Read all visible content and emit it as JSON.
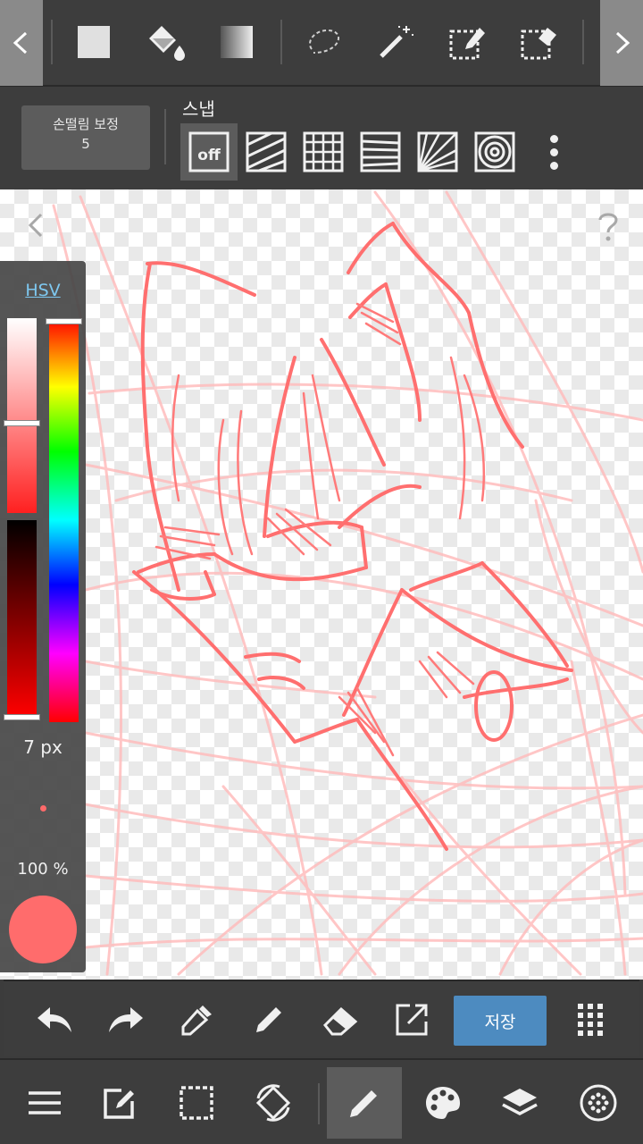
{
  "top_tools": {
    "scroll_left": "chevron-left-icon",
    "scroll_right": "chevron-right-icon",
    "items": [
      "fill-rect-icon",
      "bucket-icon",
      "gradient-icon",
      "lasso-icon",
      "magic-wand-icon",
      "select-pen-icon",
      "select-eraser-icon"
    ]
  },
  "stabilizer": {
    "label": "손떨림 보정",
    "value": "5"
  },
  "snap": {
    "label": "스냅",
    "off_label": "off",
    "modes": [
      "snap-off",
      "parallel-line",
      "grid",
      "perspective",
      "radial-line",
      "circle"
    ]
  },
  "color_panel": {
    "mode_link": "HSV",
    "brush_size": "7 px",
    "opacity": "100 %",
    "current_color": "#ff6c6c",
    "saturation_fraction": 0.55,
    "value_fraction": 1.0,
    "hue_fraction": 0.0
  },
  "actions": {
    "items": [
      "undo-icon",
      "redo-icon",
      "eyedropper-icon",
      "pen-icon",
      "eraser-icon",
      "export-icon"
    ],
    "save_label": "저장",
    "grid_menu": "dots-grid-icon"
  },
  "bottom_nav": {
    "items": [
      "menu-icon",
      "edit-icon",
      "selection-icon",
      "rotate-icon",
      "brush-icon",
      "palette-icon",
      "layers-icon",
      "materials-icon"
    ],
    "active": "brush-icon"
  },
  "colors": {
    "toolbar": "#3d3d3d",
    "accent": "#4d8bc0",
    "sketch_strong": "#ff6f6f",
    "sketch_faint": "#ffb6b6"
  }
}
